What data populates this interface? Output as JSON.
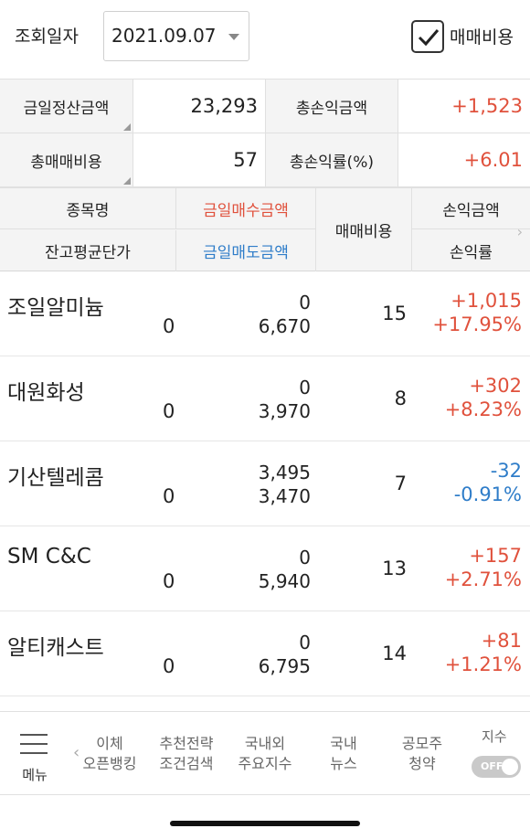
{
  "top": {
    "date_label": "조회일자",
    "date_value": "2021.09.07",
    "checkbox_label": "매매비용",
    "checkbox_checked": true
  },
  "summary": {
    "settle_label": "금일정산금액",
    "settle_value": "23,293",
    "total_pl_label": "총손익금액",
    "total_pl_value": "+1,523",
    "total_fee_label": "총매매비용",
    "total_fee_value": "57",
    "total_rate_label": "총손익률(%)",
    "total_rate_value": "+6.01"
  },
  "columns": {
    "name": "종목명",
    "avg_price": "잔고평균단가",
    "buy_amount": "금일매수금액",
    "sell_amount": "금일매도금액",
    "fee": "매매비용",
    "pl_amount": "손익금액",
    "pl_rate": "손익률"
  },
  "rows": [
    {
      "name": "조일알미늄",
      "avg": "0",
      "buy": "0",
      "sell": "6,670",
      "fee": "15",
      "pl": "+1,015",
      "rate": "+17.95%"
    },
    {
      "name": "대원화성",
      "avg": "0",
      "buy": "0",
      "sell": "3,970",
      "fee": "8",
      "pl": "+302",
      "rate": "+8.23%"
    },
    {
      "name": "기산텔레콤",
      "avg": "0",
      "buy": "3,495",
      "sell": "3,470",
      "fee": "7",
      "pl": "-32",
      "rate": "-0.91%"
    },
    {
      "name": "SM C&C",
      "avg": "0",
      "buy": "0",
      "sell": "5,940",
      "fee": "13",
      "pl": "+157",
      "rate": "+2.71%"
    },
    {
      "name": "알티캐스트",
      "avg": "0",
      "buy": "0",
      "sell": "6,795",
      "fee": "14",
      "pl": "+81",
      "rate": "+1.21%"
    }
  ],
  "colors": {
    "positive": "#e0513c",
    "negative": "#2f7dc9"
  },
  "bottom_nav": {
    "menu": "메뉴",
    "items": [
      {
        "line1": "이체",
        "line2": "오픈뱅킹"
      },
      {
        "line1": "추천전략",
        "line2": "조건검색"
      },
      {
        "line1": "국내외",
        "line2": "주요지수"
      },
      {
        "line1": "국내",
        "line2": "뉴스"
      },
      {
        "line1": "공모주",
        "line2": "청약"
      }
    ],
    "toggle_label": "지수",
    "toggle_state": "OFF"
  }
}
